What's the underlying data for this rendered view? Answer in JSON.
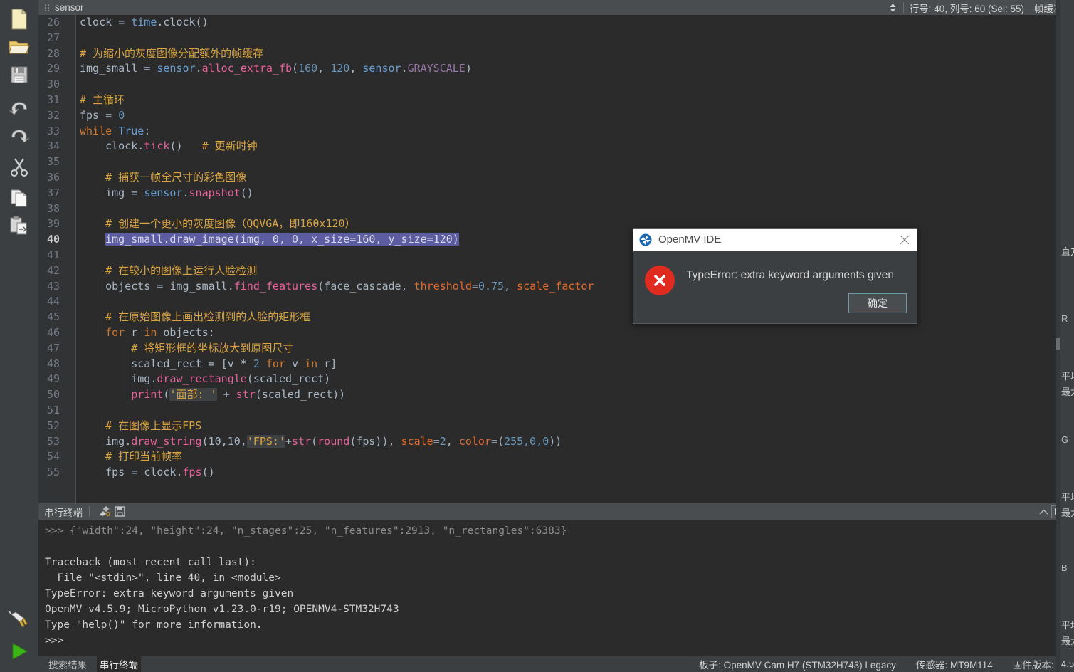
{
  "app": {
    "name": "OpenMV IDE"
  },
  "left_toolbar": {
    "items": [
      {
        "name": "new-file-icon",
        "label": "新建文件"
      },
      {
        "name": "open-file-icon",
        "label": "打开文件"
      },
      {
        "name": "save-file-icon",
        "label": "保存文件"
      },
      {
        "name": "undo-icon",
        "label": "撤销"
      },
      {
        "name": "redo-icon",
        "label": "重做"
      },
      {
        "name": "cut-icon",
        "label": "剪切"
      },
      {
        "name": "copy-icon",
        "label": "复制"
      },
      {
        "name": "paste-icon",
        "label": "粘贴"
      }
    ],
    "bottom_items": [
      {
        "name": "connect-icon",
        "label": "连接"
      },
      {
        "name": "run-icon",
        "label": "运行"
      }
    ]
  },
  "editor_header": {
    "tab_name": "sensor",
    "cursor_position": "行号: 40, 列号: 60 (Sel: 55)",
    "framebuffer_label": "帧缓冲区"
  },
  "editor": {
    "first_line_number": 26,
    "current_line": 40,
    "lines": [
      {
        "n": 26,
        "tokens": [
          {
            "t": "clock ",
            "c": "plain"
          },
          {
            "t": "= ",
            "c": "plain"
          },
          {
            "t": "time",
            "c": "mod"
          },
          {
            "t": ".clock()",
            "c": "plain"
          }
        ]
      },
      {
        "n": 27,
        "tokens": []
      },
      {
        "n": 28,
        "tokens": [
          {
            "t": "# 为缩小的灰度图像分配额外的帧缓存",
            "c": "cmt"
          }
        ]
      },
      {
        "n": 29,
        "tokens": [
          {
            "t": "img_small ",
            "c": "plain"
          },
          {
            "t": "= ",
            "c": "plain"
          },
          {
            "t": "sensor",
            "c": "mod"
          },
          {
            "t": ".",
            "c": "plain"
          },
          {
            "t": "alloc_extra_fb",
            "c": "func"
          },
          {
            "t": "(",
            "c": "plain"
          },
          {
            "t": "160",
            "c": "num"
          },
          {
            "t": ", ",
            "c": "plain"
          },
          {
            "t": "120",
            "c": "num"
          },
          {
            "t": ", ",
            "c": "plain"
          },
          {
            "t": "sensor",
            "c": "mod"
          },
          {
            "t": ".",
            "c": "plain"
          },
          {
            "t": "GRAYSCALE",
            "c": "const"
          },
          {
            "t": ")",
            "c": "plain"
          }
        ]
      },
      {
        "n": 30,
        "tokens": []
      },
      {
        "n": 31,
        "tokens": [
          {
            "t": "# 主循环",
            "c": "cmt"
          }
        ]
      },
      {
        "n": 32,
        "tokens": [
          {
            "t": "fps ",
            "c": "plain"
          },
          {
            "t": "= ",
            "c": "plain"
          },
          {
            "t": "0",
            "c": "num"
          }
        ]
      },
      {
        "n": 33,
        "tokens": [
          {
            "t": "while ",
            "c": "kw"
          },
          {
            "t": "True",
            "c": "mod"
          },
          {
            "t": ":",
            "c": "plain"
          }
        ]
      },
      {
        "n": 34,
        "indent": 1,
        "tokens": [
          {
            "t": "    clock.",
            "c": "plain"
          },
          {
            "t": "tick",
            "c": "func"
          },
          {
            "t": "()   ",
            "c": "plain"
          },
          {
            "t": "# 更新时钟",
            "c": "cmt"
          }
        ]
      },
      {
        "n": 35,
        "indent": 1,
        "tokens": []
      },
      {
        "n": 36,
        "indent": 1,
        "tokens": [
          {
            "t": "    ",
            "c": "plain"
          },
          {
            "t": "# 捕获一帧全尺寸的彩色图像",
            "c": "cmt"
          }
        ]
      },
      {
        "n": 37,
        "indent": 1,
        "tokens": [
          {
            "t": "    img ",
            "c": "plain"
          },
          {
            "t": "= ",
            "c": "plain"
          },
          {
            "t": "sensor",
            "c": "mod"
          },
          {
            "t": ".",
            "c": "plain"
          },
          {
            "t": "snapshot",
            "c": "func"
          },
          {
            "t": "()",
            "c": "plain"
          }
        ]
      },
      {
        "n": 38,
        "indent": 1,
        "tokens": []
      },
      {
        "n": 39,
        "indent": 1,
        "tokens": [
          {
            "t": "    ",
            "c": "plain"
          },
          {
            "t": "# 创建一个更小的灰度图像（QQVGA，即160x120）",
            "c": "cmt"
          }
        ]
      },
      {
        "n": 40,
        "indent": 1,
        "selected": true,
        "tokens": [
          {
            "t": "    ",
            "c": "plain"
          },
          {
            "t": "img_small.draw_image(img, 0, 0, x_size=160, y_size=120)",
            "c": "sel"
          }
        ]
      },
      {
        "n": 41,
        "indent": 1,
        "tokens": []
      },
      {
        "n": 42,
        "indent": 1,
        "tokens": [
          {
            "t": "    ",
            "c": "plain"
          },
          {
            "t": "# 在较小的图像上运行人脸检测",
            "c": "cmt"
          }
        ]
      },
      {
        "n": 43,
        "indent": 1,
        "tokens": [
          {
            "t": "    objects ",
            "c": "plain"
          },
          {
            "t": "= ",
            "c": "plain"
          },
          {
            "t": "img_small.",
            "c": "plain"
          },
          {
            "t": "find_features",
            "c": "func"
          },
          {
            "t": "(face_cascade, ",
            "c": "plain"
          },
          {
            "t": "threshold",
            "c": "param"
          },
          {
            "t": "=",
            "c": "plain"
          },
          {
            "t": "0.75",
            "c": "num"
          },
          {
            "t": ", ",
            "c": "plain"
          },
          {
            "t": "scale_factor",
            "c": "param"
          }
        ]
      },
      {
        "n": 44,
        "indent": 1,
        "tokens": []
      },
      {
        "n": 45,
        "indent": 1,
        "tokens": [
          {
            "t": "    ",
            "c": "plain"
          },
          {
            "t": "# 在原始图像上画出检测到的人脸的矩形框",
            "c": "cmt"
          }
        ]
      },
      {
        "n": 46,
        "indent": 1,
        "tokens": [
          {
            "t": "    ",
            "c": "plain"
          },
          {
            "t": "for ",
            "c": "kw"
          },
          {
            "t": "r ",
            "c": "plain"
          },
          {
            "t": "in ",
            "c": "kw"
          },
          {
            "t": "objects:",
            "c": "plain"
          }
        ]
      },
      {
        "n": 47,
        "indent": 2,
        "tokens": [
          {
            "t": "        ",
            "c": "plain"
          },
          {
            "t": "# 将矩形框的坐标放大到原图尺寸",
            "c": "cmt"
          }
        ]
      },
      {
        "n": 48,
        "indent": 2,
        "tokens": [
          {
            "t": "        scaled_rect ",
            "c": "plain"
          },
          {
            "t": "= ",
            "c": "plain"
          },
          {
            "t": "[v ",
            "c": "plain"
          },
          {
            "t": "* ",
            "c": "plain"
          },
          {
            "t": "2 ",
            "c": "num"
          },
          {
            "t": "for ",
            "c": "kw"
          },
          {
            "t": "v ",
            "c": "plain"
          },
          {
            "t": "in ",
            "c": "kw"
          },
          {
            "t": "r]",
            "c": "plain"
          }
        ]
      },
      {
        "n": 49,
        "indent": 2,
        "tokens": [
          {
            "t": "        img.",
            "c": "plain"
          },
          {
            "t": "draw_rectangle",
            "c": "func"
          },
          {
            "t": "(scaled_rect)",
            "c": "plain"
          }
        ]
      },
      {
        "n": 50,
        "indent": 2,
        "tokens": [
          {
            "t": "        ",
            "c": "plain"
          },
          {
            "t": "print",
            "c": "func"
          },
          {
            "t": "(",
            "c": "plain"
          },
          {
            "t": "'面部: '",
            "c": "str"
          },
          {
            "t": " + ",
            "c": "plain"
          },
          {
            "t": "str",
            "c": "func"
          },
          {
            "t": "(scaled_rect))",
            "c": "plain"
          }
        ]
      },
      {
        "n": 51,
        "indent": 1,
        "tokens": []
      },
      {
        "n": 52,
        "indent": 1,
        "tokens": [
          {
            "t": "    ",
            "c": "plain"
          },
          {
            "t": "# 在图像上显示FPS",
            "c": "cmt"
          }
        ]
      },
      {
        "n": 53,
        "indent": 1,
        "tokens": [
          {
            "t": "    img.",
            "c": "plain"
          },
          {
            "t": "draw_string",
            "c": "func"
          },
          {
            "t": "(10,10,",
            "c": "plain"
          },
          {
            "t": "'FPS:'",
            "c": "str"
          },
          {
            "t": "+",
            "c": "plain"
          },
          {
            "t": "str",
            "c": "func"
          },
          {
            "t": "(",
            "c": "plain"
          },
          {
            "t": "round",
            "c": "func"
          },
          {
            "t": "(fps)), ",
            "c": "plain"
          },
          {
            "t": "scale",
            "c": "param"
          },
          {
            "t": "=",
            "c": "plain"
          },
          {
            "t": "2",
            "c": "num"
          },
          {
            "t": ", ",
            "c": "plain"
          },
          {
            "t": "color",
            "c": "param"
          },
          {
            "t": "=(",
            "c": "plain"
          },
          {
            "t": "255,0,0",
            "c": "num"
          },
          {
            "t": "))",
            "c": "plain"
          }
        ]
      },
      {
        "n": 54,
        "indent": 1,
        "tokens": [
          {
            "t": "    ",
            "c": "plain"
          },
          {
            "t": "# 打印当前帧率",
            "c": "cmt"
          }
        ]
      },
      {
        "n": 55,
        "indent": 1,
        "tokens": [
          {
            "t": "    fps ",
            "c": "plain"
          },
          {
            "t": "= ",
            "c": "plain"
          },
          {
            "t": "clock.",
            "c": "plain"
          },
          {
            "t": "fps",
            "c": "func"
          },
          {
            "t": "()",
            "c": "plain"
          }
        ]
      }
    ]
  },
  "terminal": {
    "title": "串行终端",
    "clear_icon": "clear-icon",
    "save_icon": "save-icon",
    "collapse_icon": "chevron-up-icon",
    "maximize_icon": "maximize-icon",
    "lines": [
      {
        "text": ">>> {\"width\":24, \"height\":24, \"n_stages\":25, \"n_features\":2913, \"n_rectangles\":6383}",
        "dim": true
      },
      {
        "text": "",
        "dim": false
      },
      {
        "text": "Traceback (most recent call last):",
        "dim": false
      },
      {
        "text": "  File \"<stdin>\", line 40, in <module>",
        "dim": false
      },
      {
        "text": "TypeError: extra keyword arguments given",
        "dim": false
      },
      {
        "text": "OpenMV v4.5.9; MicroPython v1.23.0-r19; OPENMV4-STM32H743",
        "dim": false
      },
      {
        "text": "Type \"help()\" for more information.",
        "dim": false
      },
      {
        "text": ">>>",
        "dim": false
      }
    ]
  },
  "status_bar": {
    "tabs": [
      {
        "label": "搜索结果",
        "active": false
      },
      {
        "label": "串行终端",
        "active": true
      }
    ],
    "board": "板子: OpenMV Cam H7 (STM32H743) Legacy",
    "sensor": "传感器: MT9M114",
    "firmware": "固件版本: 4.5"
  },
  "dialog": {
    "title": "OpenMV IDE",
    "message": "TypeError: extra keyword arguments given",
    "ok_label": "确定",
    "close_icon": "close-icon",
    "error_icon": "error-icon",
    "logo_icon": "openmv-logo-icon"
  },
  "right_panel": {
    "histogram_label": "直方",
    "entries": [
      {
        "channel": "R",
        "mean": "平均",
        "max": "最大"
      },
      {
        "channel": "G",
        "mean": "平均",
        "max": "最大"
      },
      {
        "channel": "B",
        "mean": "平均",
        "max": "最大"
      }
    ],
    "firmware_fragment": "4.5"
  },
  "colors": {
    "editor_bg": "#2b2b2b",
    "panel_bg": "#3c3f41",
    "header_bg": "#4a4d4f",
    "selection": "#5c5ca0",
    "comment": "#d9a441",
    "keyword": "#cc7832",
    "function": "#e8629b",
    "number": "#6897bb",
    "error_red": "#e02b20",
    "run_green": "#3cb518"
  }
}
